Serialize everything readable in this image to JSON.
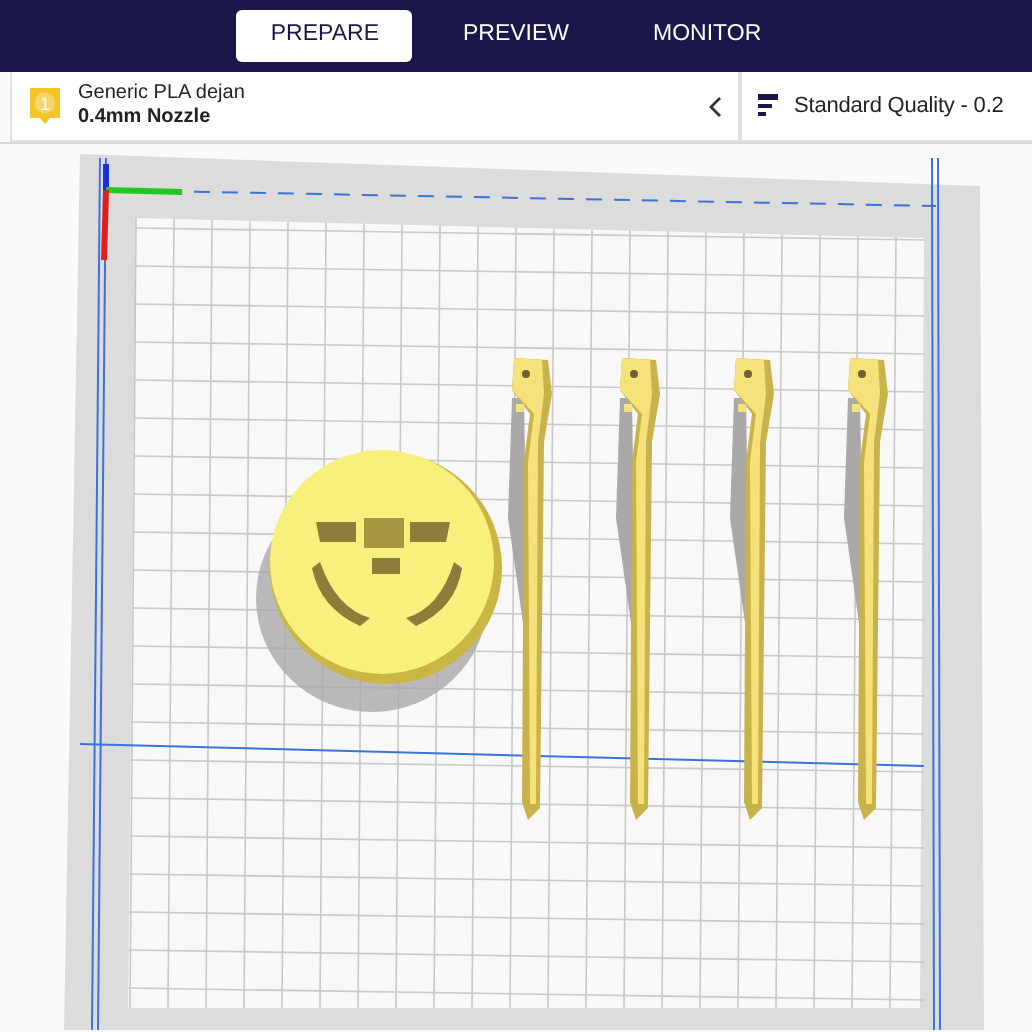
{
  "tabs": [
    {
      "label": "PREPARE",
      "selected": true
    },
    {
      "label": "PREVIEW",
      "selected": false
    },
    {
      "label": "MONITOR",
      "selected": false
    }
  ],
  "extruder": {
    "number": "1",
    "material": "Generic PLA dejan",
    "nozzle": "0.4mm Nozzle"
  },
  "quality": {
    "label": "Standard Quality - 0.2"
  }
}
